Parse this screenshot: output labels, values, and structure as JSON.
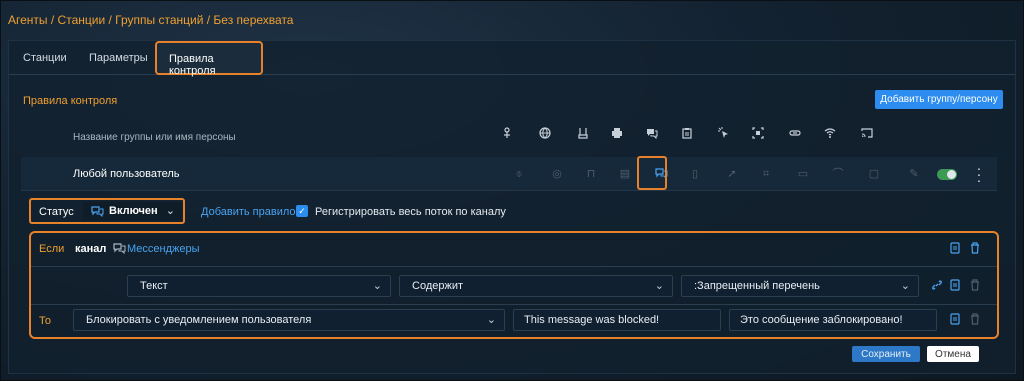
{
  "breadcrumb": "Агенты / Станции / Группы станций / Без перехвата",
  "tabs": [
    {
      "label": "Станции"
    },
    {
      "label": "Параметры"
    },
    {
      "label": "Правила контроля"
    }
  ],
  "section_title": "Правила контроля",
  "add_group_button": "Добавить группу/персону",
  "header": {
    "name_label": "Название группы или имя персоны",
    "icons": [
      "usb-icon",
      "globe-icon",
      "wifi-adapter-icon",
      "printer-icon",
      "messenger-icon",
      "clipboard-icon",
      "screenshot-icon",
      "screen-capture-icon",
      "network-icon",
      "wifi-icon",
      "cast-icon"
    ]
  },
  "user_row": {
    "name": "Любой пользователь",
    "enabled": true
  },
  "status": {
    "label": "Статус",
    "value": "Включен"
  },
  "add_rule_link": "Добавить правило",
  "register_stream": {
    "label": "Регистрировать весь поток по каналу",
    "checked": true
  },
  "rule": {
    "if_label": "Если",
    "channel_label": "канал",
    "channel_value": "Мессенджеры",
    "condition": {
      "field": "Текст",
      "operator": "Содержит",
      "value": ":Запрещенный перечень"
    },
    "then_label": "То",
    "action": "Блокировать с уведомлением пользователя",
    "message_en": "This message was blocked!",
    "message_ru": "Это сообщение заблокировано!"
  },
  "footer": {
    "save": "Сохранить",
    "cancel": "Отмена"
  },
  "colors": {
    "accent_orange": "#e8822a",
    "link_blue": "#4aa3f0",
    "button_blue": "#2d8cf0"
  }
}
